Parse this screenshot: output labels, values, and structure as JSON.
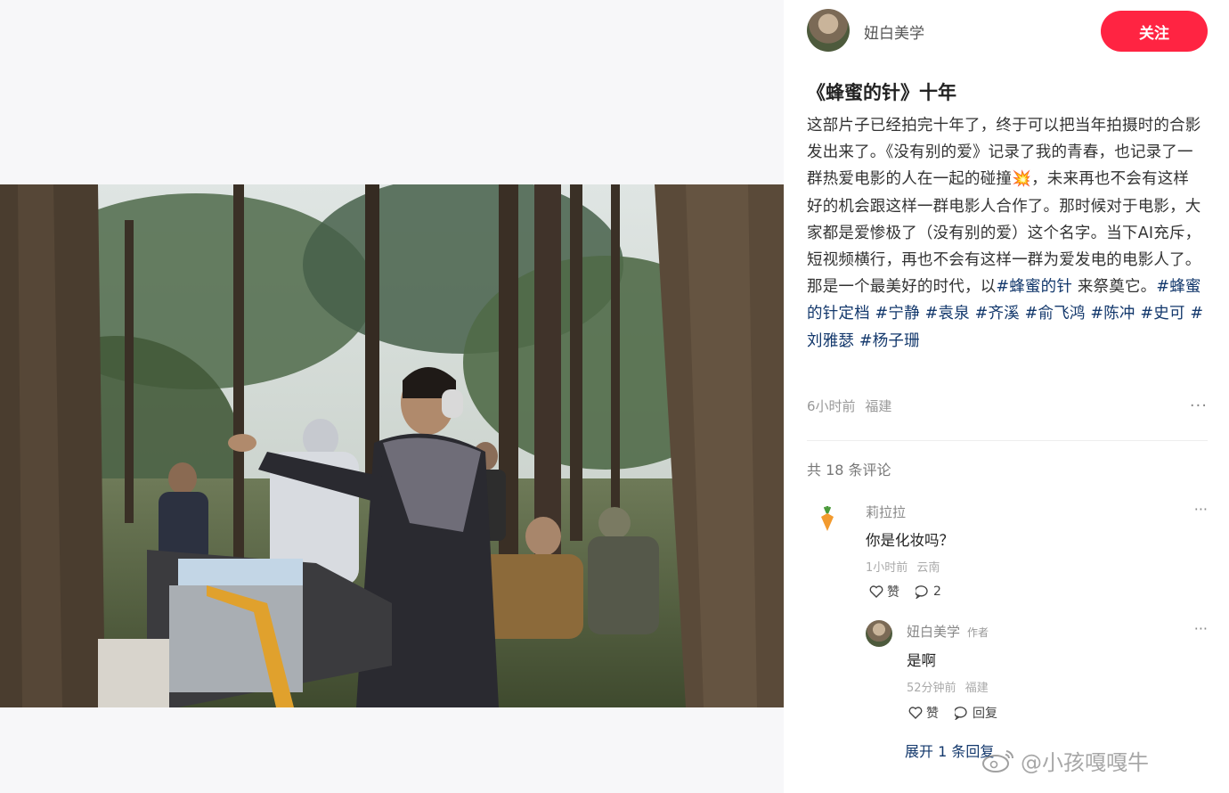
{
  "author": {
    "name": "妞白美学",
    "follow_label": "关注"
  },
  "post": {
    "title": "《蜂蜜的针》十年",
    "body_text": "这部片子已经拍完十年了，终于可以把当年拍摄时的合影发出来了。《没有别的爱》记录了我的青春，也记录了一群热爱电影的人在一起的碰撞",
    "body_emoji": "💥",
    "body_text_2": "，未来再也不会有这样好的机会跟这样一群电影人合作了。那时候对于电影，大家都是爱惨极了（没有别的爱）这个名字。当下AI充斥，短视频横行，再也不会有这样一群为爱发电的电影人了。那是一个最美好的时代，以",
    "tags_inline": "#蜂蜜的针",
    "body_text_3": " 来祭奠它。",
    "tags": "#蜂蜜的针定档 #宁静 #袁泉 #齐溪 #俞飞鸿 #陈冲 #史可 #刘雅瑟 #杨子珊",
    "time": "6小时前",
    "location": "福建",
    "more": "···"
  },
  "comments_header": "共 18 条评论",
  "comments": [
    {
      "name": "莉拉拉",
      "text": "你是化妆吗？",
      "time": "1小时前",
      "location": "云南",
      "like_label": "赞",
      "reply_count": "2",
      "more": "···"
    },
    {
      "name": "妞白美学",
      "badge": "作者",
      "text": "是啊",
      "time": "52分钟前",
      "location": "福建",
      "like_label": "赞",
      "reply_label": "回复",
      "more": "···"
    }
  ],
  "expand_label": "展开 1 条回复",
  "watermark": "@小孩嘎嘎牛",
  "colors": {
    "accent": "#ff2442",
    "tag": "#13386c"
  },
  "icons": {
    "carrot_avatar": "carrot-icon",
    "like": "heart-icon",
    "reply": "speech-bubble-icon",
    "weibo": "weibo-logo"
  }
}
